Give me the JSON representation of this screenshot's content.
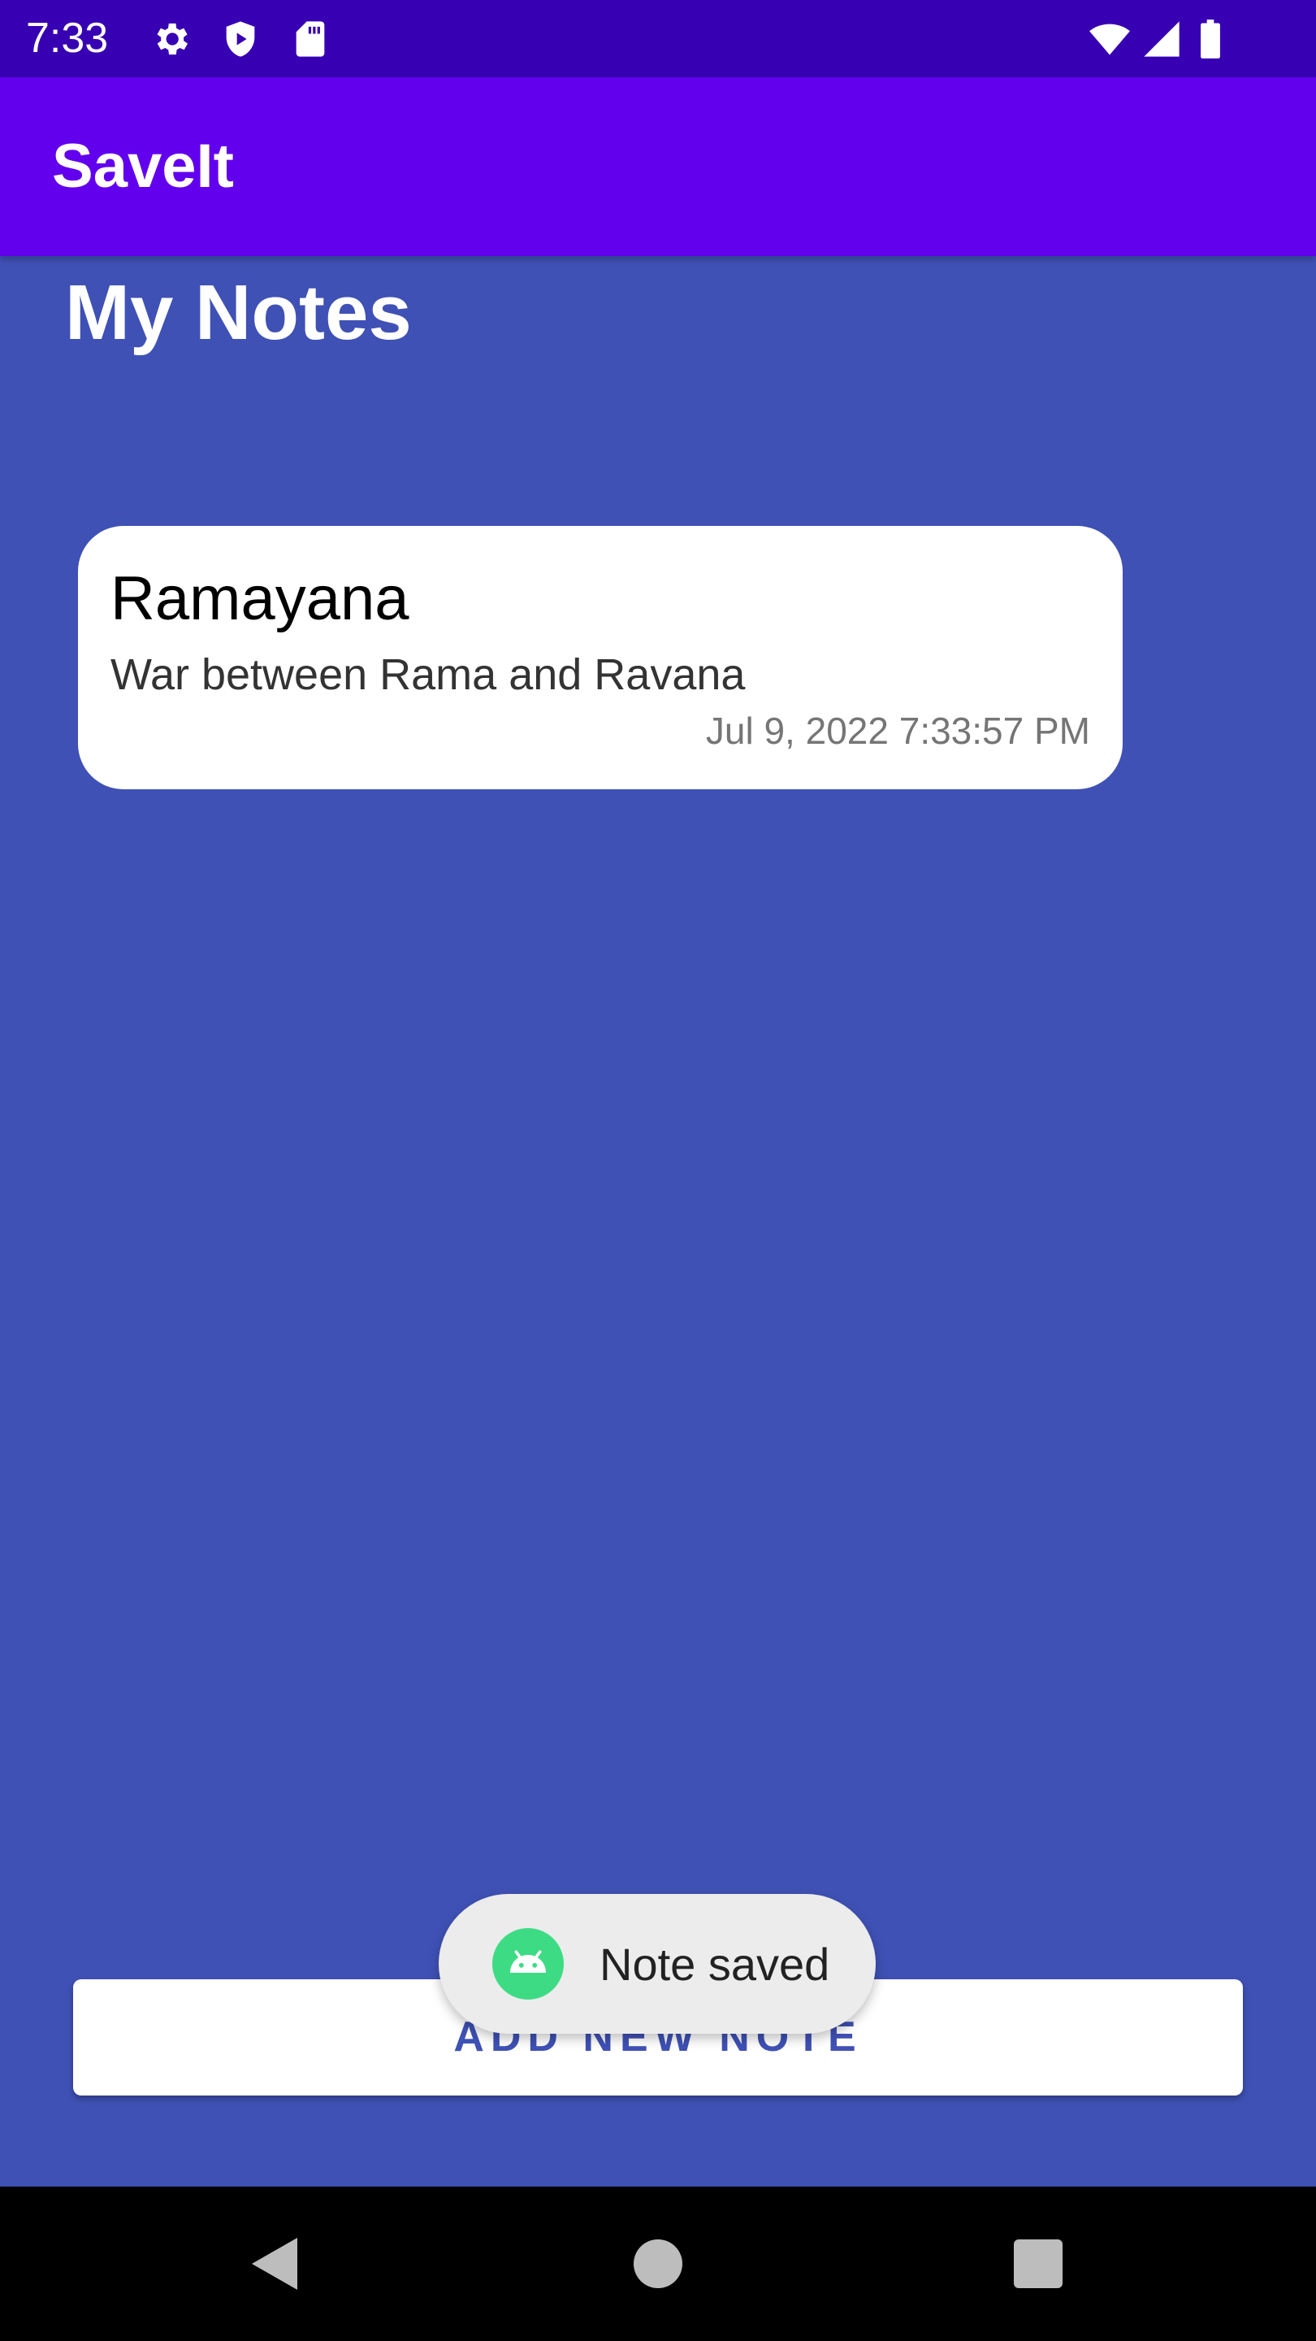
{
  "status_bar": {
    "time": "7:33",
    "icons": [
      "gear-icon",
      "shield-play-icon",
      "sd-card-icon",
      "wifi-icon",
      "signal-icon",
      "battery-icon"
    ]
  },
  "app_bar": {
    "title": "SaveIt",
    "color": "#6200EE"
  },
  "main": {
    "page_title": "My Notes",
    "background_color": "#3F51B5",
    "notes": [
      {
        "title": "Ramayana",
        "description": "War between Rama and Ravana",
        "date": "Jul 9, 2022 7:33:57 PM"
      }
    ],
    "add_button_label": "ADD NEW NOTE"
  },
  "toast": {
    "icon": "android-icon",
    "message": "Note saved"
  },
  "nav_bar": {
    "buttons": [
      "back-icon",
      "home-icon",
      "recents-icon"
    ]
  }
}
